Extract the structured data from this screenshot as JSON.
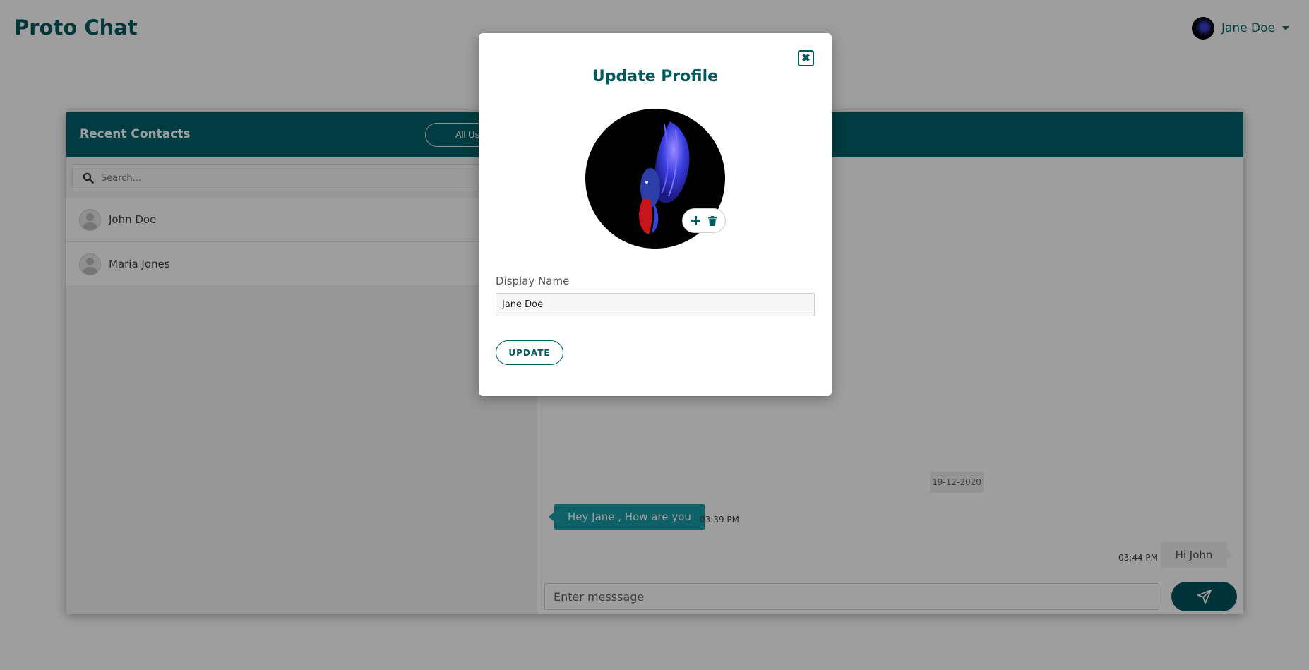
{
  "app": {
    "title": "Proto Chat"
  },
  "user_menu": {
    "name": "Jane Doe",
    "avatar_icon": "fish-avatar"
  },
  "panel": {
    "title": "Recent Contacts",
    "all_users_label": "All Users",
    "search_placeholder": "Search...",
    "contacts": [
      {
        "name": "John Doe",
        "avatar_icon": "user-placeholder-icon"
      },
      {
        "name": "Maria Jones",
        "avatar_icon": "user-placeholder-icon"
      }
    ]
  },
  "chat": {
    "date": "19-12-2020",
    "messages": [
      {
        "direction": "in",
        "text": "Hey Jane , How are you",
        "time": "03:39 PM"
      },
      {
        "direction": "out",
        "text": "Hi John",
        "time": "03:44 PM"
      }
    ],
    "input_placeholder": "Enter messsage",
    "send_icon": "paper-plane-icon"
  },
  "modal": {
    "title": "Update Profile",
    "close_symbol": "✖",
    "photo_icon": "betta-fish-photo",
    "add_photo_icon": "plus-icon",
    "delete_photo_icon": "trash-icon",
    "display_name_label": "Display Name",
    "display_name_value": "Jane Doe",
    "update_label": "UPDATE"
  },
  "colors": {
    "brand": "#025a5f",
    "header": "#00616a",
    "incoming_bubble": "#179ea6",
    "send_button": "#00545b"
  }
}
